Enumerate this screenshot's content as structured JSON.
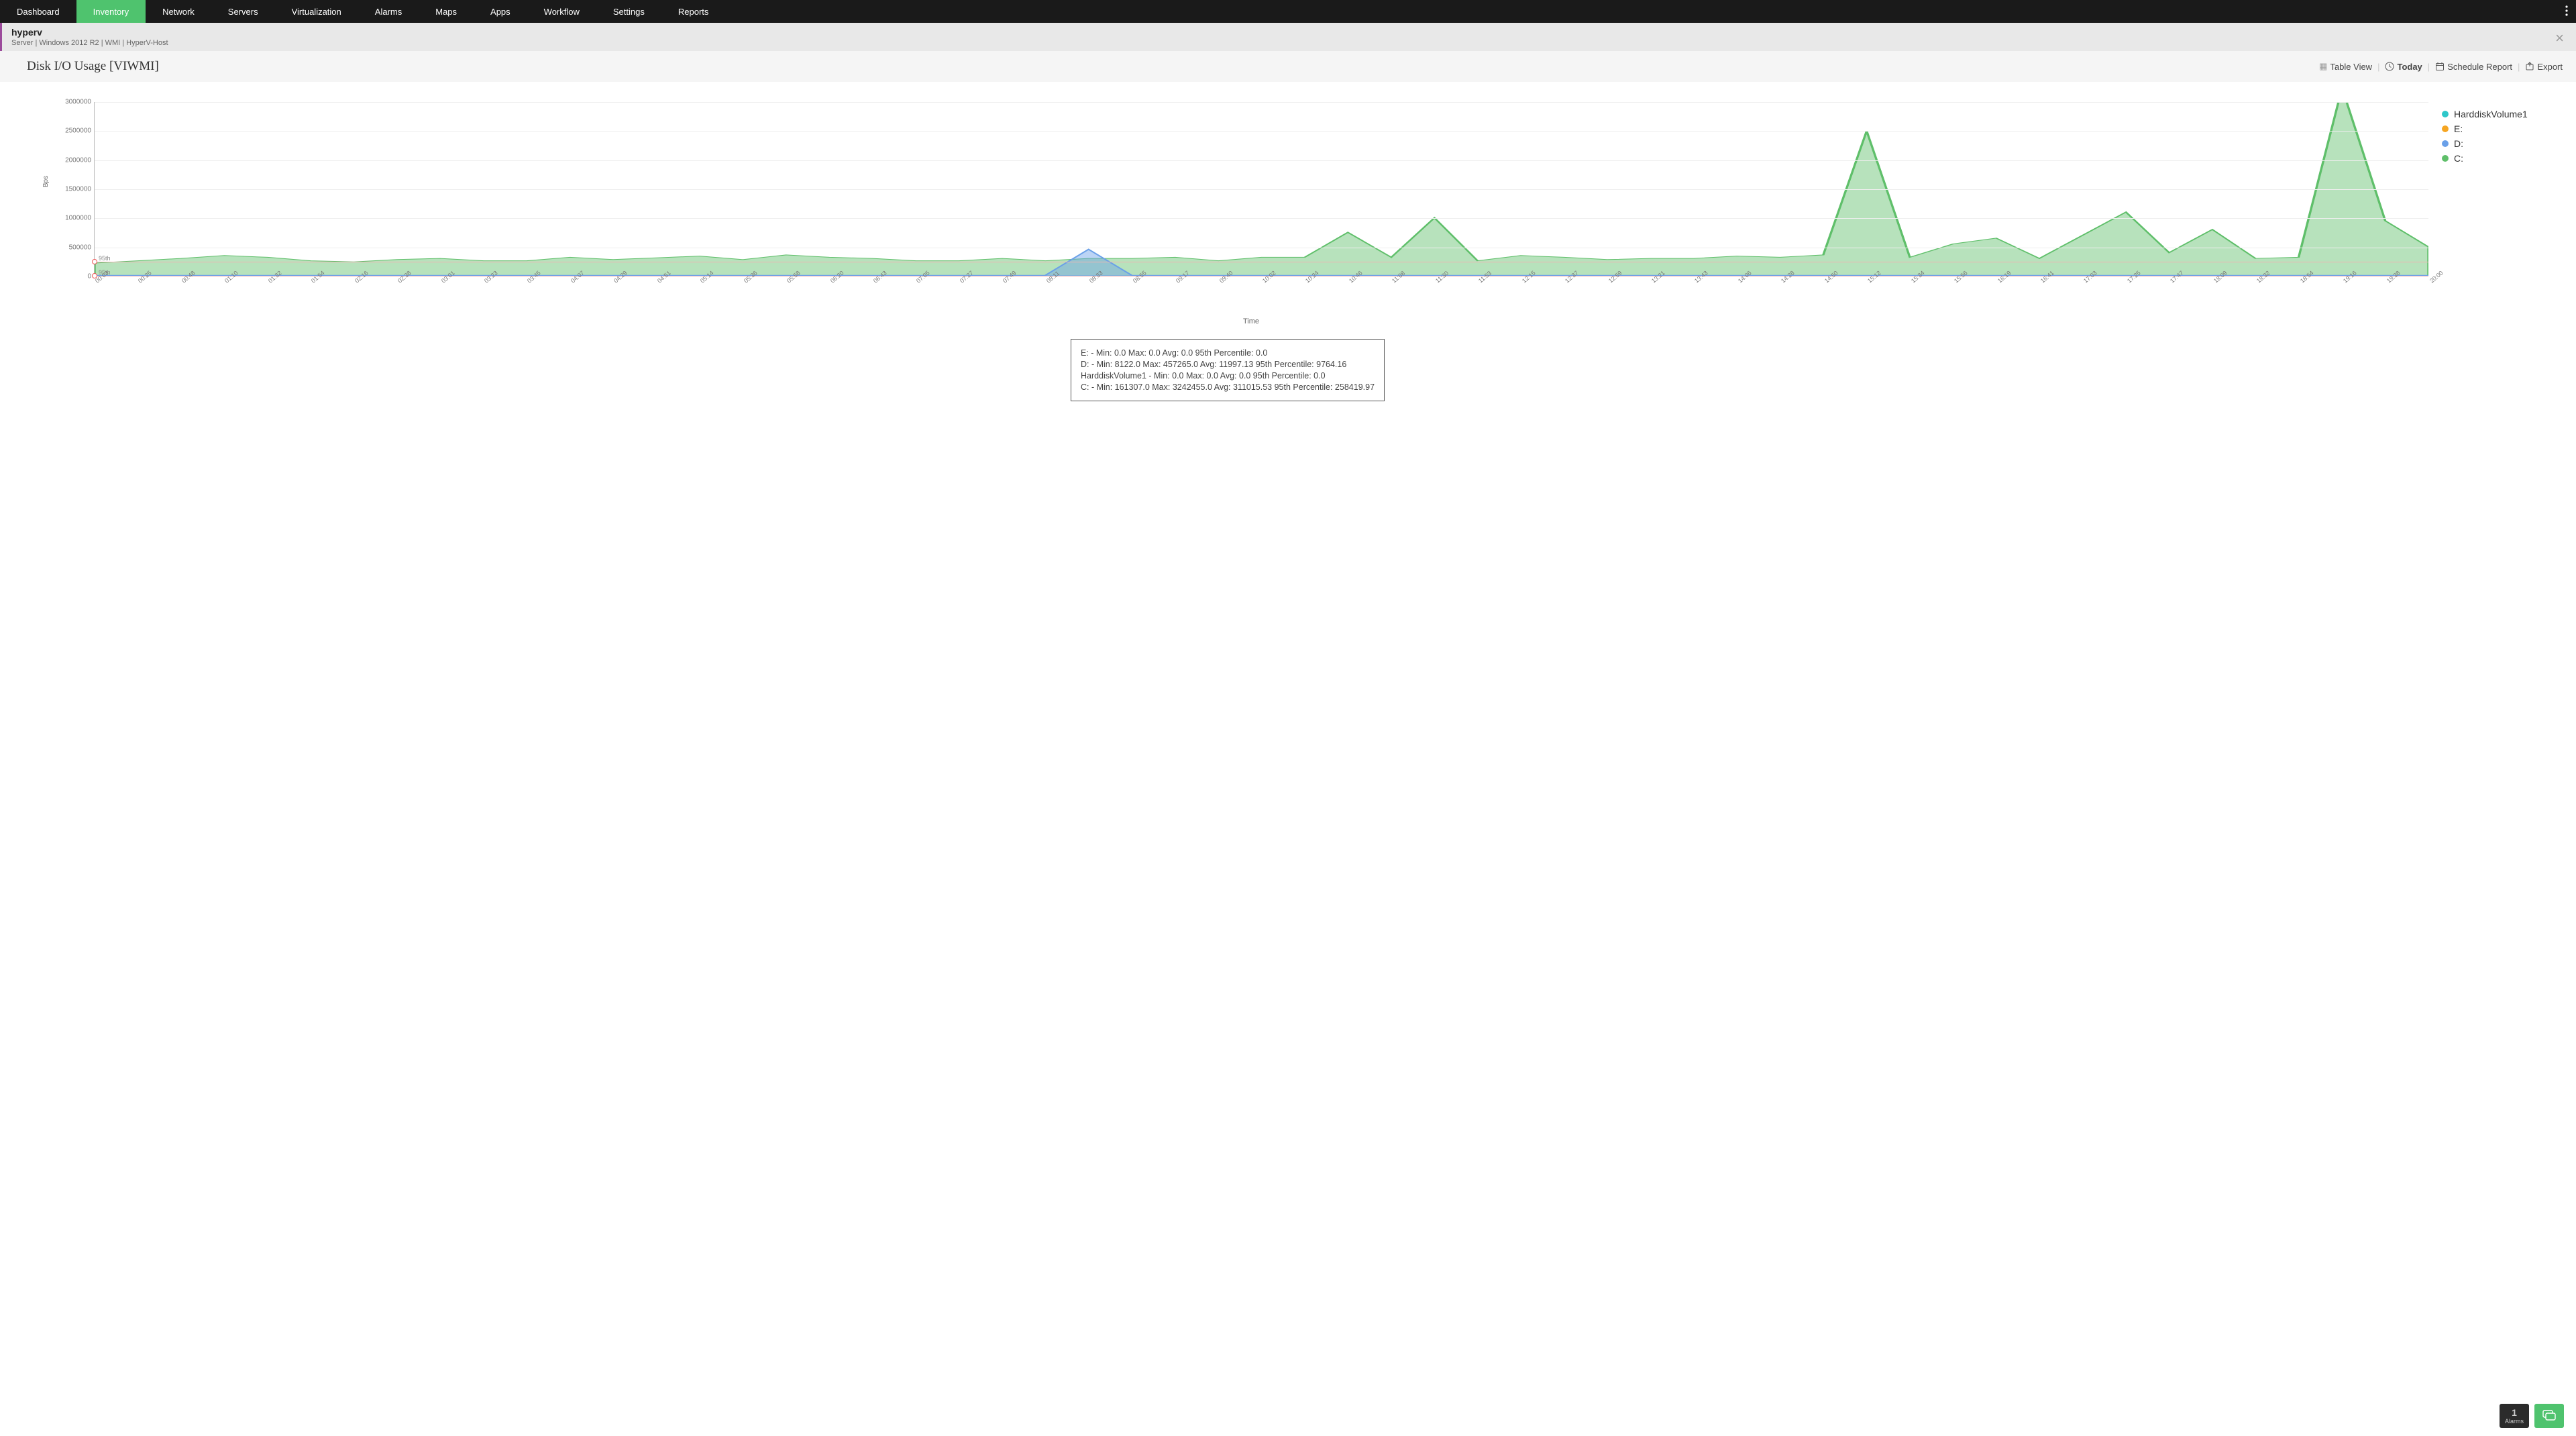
{
  "nav": {
    "items": [
      "Dashboard",
      "Inventory",
      "Network",
      "Servers",
      "Virtualization",
      "Alarms",
      "Maps",
      "Apps",
      "Workflow",
      "Settings",
      "Reports"
    ],
    "active_index": 1
  },
  "header": {
    "title": "hyperv",
    "subtitle": "Server  |  Windows 2012 R2   |  WMI   |  HyperV-Host"
  },
  "page": {
    "title": "Disk I/O Usage [VIWMI]",
    "actions": {
      "table_view": "Table View",
      "today": "Today",
      "schedule": "Schedule Report",
      "export": "Export"
    }
  },
  "legend": [
    {
      "name": "HarddiskVolume1",
      "color": "#2ec7c9"
    },
    {
      "name": "E:",
      "color": "#f6a623"
    },
    {
      "name": "D:",
      "color": "#6aa0e8"
    },
    {
      "name": "C:",
      "color": "#5fbf6a"
    }
  ],
  "stats": [
    "E: - Min: 0.0 Max: 0.0 Avg: 0.0 95th Percentile: 0.0",
    "D: - Min: 8122.0 Max: 457265.0 Avg: 11997.13 95th Percentile: 9764.16",
    "HarddiskVolume1 - Min: 0.0 Max: 0.0 Avg: 0.0 95th Percentile: 0.0",
    "C: - Min: 161307.0 Max: 3242455.0 Avg: 311015.53 95th Percentile: 258419.97"
  ],
  "footer": {
    "alarm_count": "1",
    "alarm_label": "Alarms"
  },
  "chart_data": {
    "type": "area",
    "title": "Disk I/O Usage [VIWMI]",
    "xlabel": "Time",
    "ylabel": "Bps",
    "ylim": [
      0,
      3000000
    ],
    "y_ticks": [
      0,
      500000,
      1000000,
      1500000,
      2000000,
      2500000,
      3000000
    ],
    "percentile_lines": [
      {
        "label": "95th",
        "value": 258419.97
      },
      {
        "label": "95th",
        "value": 9764.16
      }
    ],
    "categories": [
      "00:03",
      "00:25",
      "00:48",
      "01:10",
      "01:32",
      "01:54",
      "02:16",
      "02:38",
      "03:01",
      "03:23",
      "03:45",
      "04:07",
      "04:29",
      "04:51",
      "05:14",
      "05:36",
      "05:58",
      "06:20",
      "06:43",
      "07:05",
      "07:27",
      "07:49",
      "08:11",
      "08:33",
      "08:55",
      "09:17",
      "09:40",
      "10:02",
      "10:24",
      "10:46",
      "11:08",
      "11:30",
      "11:53",
      "12:15",
      "12:37",
      "12:59",
      "13:21",
      "13:43",
      "14:06",
      "14:28",
      "14:50",
      "15:12",
      "15:34",
      "15:56",
      "16:19",
      "16:41",
      "17:03",
      "17:25",
      "17:47",
      "18:09",
      "18:32",
      "18:54",
      "19:16",
      "19:38",
      "20:00"
    ],
    "series": [
      {
        "name": "HarddiskVolume1",
        "color": "#2ec7c9",
        "values": [
          0,
          0,
          0,
          0,
          0,
          0,
          0,
          0,
          0,
          0,
          0,
          0,
          0,
          0,
          0,
          0,
          0,
          0,
          0,
          0,
          0,
          0,
          0,
          0,
          0,
          0,
          0,
          0,
          0,
          0,
          0,
          0,
          0,
          0,
          0,
          0,
          0,
          0,
          0,
          0,
          0,
          0,
          0,
          0,
          0,
          0,
          0,
          0,
          0,
          0,
          0,
          0,
          0,
          0,
          0
        ]
      },
      {
        "name": "E:",
        "color": "#f6a623",
        "values": [
          0,
          0,
          0,
          0,
          0,
          0,
          0,
          0,
          0,
          0,
          0,
          0,
          0,
          0,
          0,
          0,
          0,
          0,
          0,
          0,
          0,
          0,
          0,
          0,
          0,
          0,
          0,
          0,
          0,
          0,
          0,
          0,
          0,
          0,
          0,
          0,
          0,
          0,
          0,
          0,
          0,
          0,
          0,
          0,
          0,
          0,
          0,
          0,
          0,
          0,
          0,
          0,
          0,
          0,
          0
        ]
      },
      {
        "name": "D:",
        "color": "#6aa0e8",
        "values": [
          8122,
          9000,
          9500,
          9000,
          9500,
          9000,
          9500,
          9000,
          9500,
          9000,
          9500,
          9000,
          9500,
          9000,
          9500,
          9000,
          9500,
          9000,
          9500,
          9000,
          9500,
          9000,
          9500,
          457265,
          9500,
          9000,
          9500,
          9000,
          9500,
          9000,
          9500,
          9000,
          9500,
          9000,
          9500,
          9000,
          9500,
          9000,
          9500,
          9000,
          9500,
          9000,
          9500,
          9000,
          9500,
          9000,
          9500,
          9000,
          9500,
          9000,
          9500,
          9000,
          9500,
          9000,
          9500
        ]
      },
      {
        "name": "C:",
        "color": "#5fbf6a",
        "values": [
          220000,
          260000,
          300000,
          350000,
          320000,
          260000,
          240000,
          280000,
          300000,
          260000,
          260000,
          320000,
          280000,
          310000,
          340000,
          280000,
          360000,
          320000,
          300000,
          260000,
          260000,
          300000,
          260000,
          300000,
          300000,
          320000,
          260000,
          320000,
          320000,
          750000,
          320000,
          1000000,
          260000,
          350000,
          320000,
          280000,
          300000,
          300000,
          340000,
          320000,
          360000,
          2500000,
          320000,
          550000,
          650000,
          300000,
          700000,
          1100000,
          400000,
          800000,
          300000,
          320000,
          3242455,
          950000,
          500000
        ]
      }
    ]
  }
}
